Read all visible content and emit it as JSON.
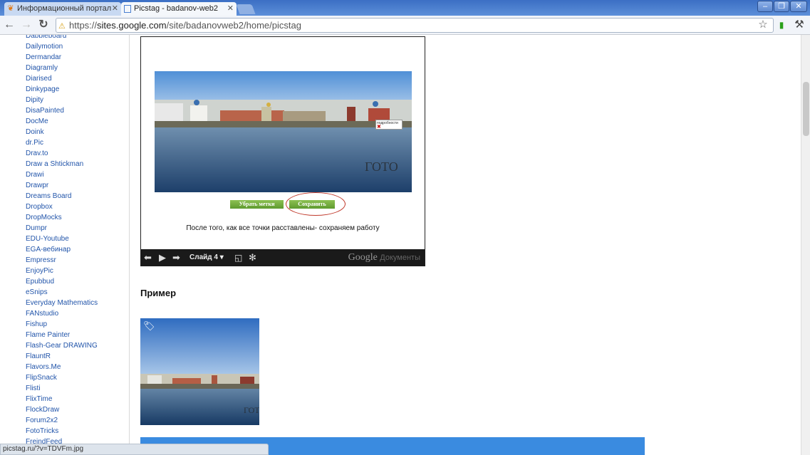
{
  "browser": {
    "tabs": [
      {
        "title": "Информационный портал",
        "active": false,
        "icon": "orange-leaf-icon"
      },
      {
        "title": "Picstag - badanov-web2",
        "active": true,
        "icon": "page-icon"
      }
    ],
    "window_buttons": [
      "–",
      "❐",
      "✕"
    ],
    "url": {
      "scheme": "https://",
      "host": "sites.google.com",
      "path": "/site/badanovweb2/home/picstag"
    },
    "status_text": "picstag.ru/?v=TDVFm.jpg"
  },
  "sidebar": {
    "items": [
      "Dabbleboard",
      "Dailymotion",
      "Dermandar",
      "Diagramly",
      "Diarised",
      "Dinkypage",
      "Dipity",
      "DisaPainted",
      "DocMe",
      "Doink",
      "dr.Pic",
      "Drav.to",
      "Draw a Shtickman",
      "Drawi",
      "Drawpr",
      "Dreams Board",
      "Dropbox",
      "DropMocks",
      "Dumpr",
      "EDU-Youtube",
      "EGA-вебинар",
      "Empressr",
      "EnjoyPic",
      "Epubbud",
      "eSnips",
      "Everyday Mathematics",
      "FANstudio",
      "Fishup",
      "Flame Painter",
      "Flash-Gear DRAWING",
      "FlauntR",
      "Flavors.Me",
      "FlipSnack",
      "Flisti",
      "FlixTime",
      "FlockDraw",
      "Forum2x2",
      "FotoTricks",
      "FreindFeed"
    ]
  },
  "slides": {
    "remove_tags_label": "Убрать метки",
    "save_label": "Сохранить",
    "popup_text": "подробности",
    "caption": "После того, как все точки расставлены- сохраняем работу",
    "slide_label": "Слайд 4",
    "brand_google": "Google",
    "brand_docs": "Документы"
  },
  "main": {
    "example_heading": "Пример"
  },
  "colors": {
    "link": "#2255aa",
    "chrome_blue": "#4a7fd0",
    "green_button": "#6aa73a",
    "highlight_red": "#c0392b"
  }
}
